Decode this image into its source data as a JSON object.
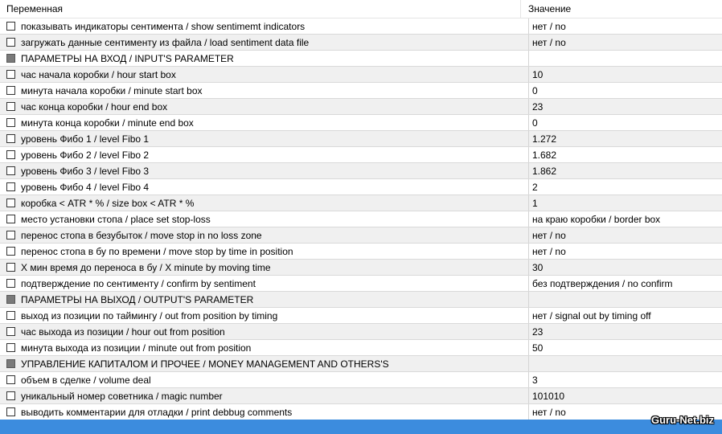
{
  "header": {
    "col_variable": "Переменная",
    "col_value": "Значение"
  },
  "rows": [
    {
      "label": "показывать индикаторы сентимента / show sentimemt indicators",
      "value": "нет / no",
      "section": false
    },
    {
      "label": "загружать данные сентименту из файла / load sentiment data file",
      "value": "нет / no",
      "section": false
    },
    {
      "label": "ПАРАМЕТРЫ НА ВХОД / INPUT'S PARAMETER",
      "value": "",
      "section": true
    },
    {
      "label": "час начала коробки / hour start box",
      "value": "10",
      "section": false
    },
    {
      "label": "минута начала коробки / minute start box",
      "value": "0",
      "section": false
    },
    {
      "label": "час конца коробки / hour end box",
      "value": "23",
      "section": false
    },
    {
      "label": "минута конца коробки / minute end box",
      "value": "0",
      "section": false
    },
    {
      "label": "уровень Фибо 1 / level Fibo 1",
      "value": "1.272",
      "section": false
    },
    {
      "label": "уровень Фибо 2 / level Fibo 2",
      "value": "1.682",
      "section": false
    },
    {
      "label": "уровень Фибо 3 / level Fibo 3",
      "value": "1.862",
      "section": false
    },
    {
      "label": "уровень Фибо 4 / level Fibo 4",
      "value": "2",
      "section": false
    },
    {
      "label": "коробка < ATR * % / size box < ATR * %",
      "value": "1",
      "section": false
    },
    {
      "label": "место установки стопа / place set stop-loss",
      "value": "на краю коробки / border box",
      "section": false
    },
    {
      "label": "перенос стопа в безубыток / move stop in no loss zone",
      "value": "нет / no",
      "section": false
    },
    {
      "label": "перенос стопа в бу по времени / move stop by time in position",
      "value": "нет / no",
      "section": false
    },
    {
      "label": "X мин время до переноса в бу / X minute by moving time",
      "value": "30",
      "section": false
    },
    {
      "label": "подтверждение по сентименту / confirm by sentiment",
      "value": "без подтверждения / no confirm",
      "section": false
    },
    {
      "label": "ПАРАМЕТРЫ НА ВЫХОД / OUTPUT'S PARAMETER",
      "value": "",
      "section": true
    },
    {
      "label": "выход из позиции по таймингу / out from position by timing",
      "value": "нет / signal out by timing off",
      "section": false
    },
    {
      "label": "час выхода из позиции / hour out from position",
      "value": "23",
      "section": false
    },
    {
      "label": "минута выхода из позиции / minute out from position",
      "value": "50",
      "section": false
    },
    {
      "label": "УПРАВЛЕНИЕ КАПИТАЛОМ И ПРОЧЕЕ / MONEY MANAGEMENT AND OTHERS'S",
      "value": "",
      "section": true
    },
    {
      "label": "объем в сделке / volume deal",
      "value": "3",
      "section": false
    },
    {
      "label": "уникальный номер советника / magic number",
      "value": "101010",
      "section": false
    },
    {
      "label": "выводить комментарии для отладки / print debbug comments",
      "value": "нет / no",
      "section": false
    }
  ],
  "watermark": "Guru-Net.biz",
  "colors": {
    "footer": "#3c8cde",
    "alt_row": "#f0f0f0"
  }
}
